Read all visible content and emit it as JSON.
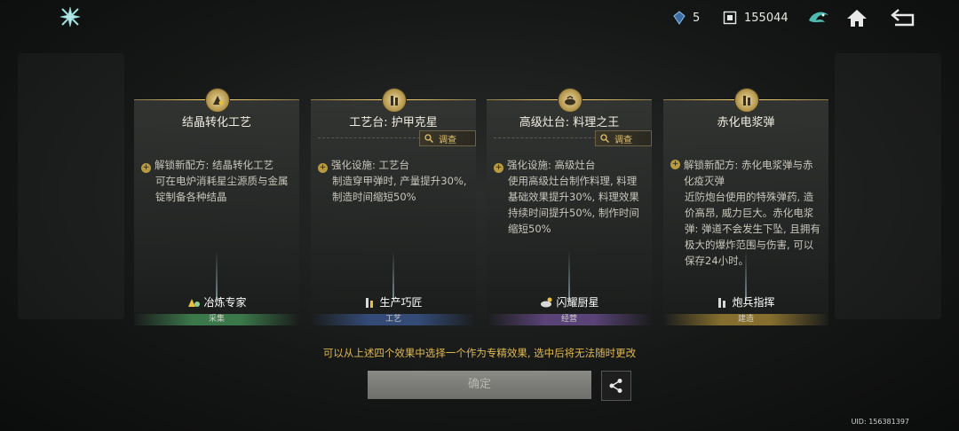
{
  "topbar": {
    "logo_icon": "shuriken-logo-icon",
    "resource1": {
      "icon": "crystal-icon",
      "value": "5"
    },
    "resource2": {
      "icon": "coin-icon",
      "value": "155044"
    },
    "buttons": [
      "dragon-emblem-icon",
      "home-icon",
      "back-icon"
    ]
  },
  "cards": [
    {
      "title": "结晶转化工艺",
      "badge_icon": "crystal-craft-icon",
      "lead": "解锁新配方: 结晶转化工艺",
      "body": "可在电炉消耗星尘源质与金属锭制备各种结晶",
      "skill": "冶炼专家",
      "category": "采集",
      "category_color": "#46965a"
    },
    {
      "title": "工艺台: 护甲克星",
      "badge_icon": "tower-icon",
      "inspect": "调查",
      "lead": "强化设施: 工艺台",
      "body": "制造穿甲弹时, 产量提升30%, 制造时间缩短50%",
      "skill": "生产巧匠",
      "category": "工艺",
      "category_color": "#3c5a96"
    },
    {
      "title": "高级灶台: 料理之王",
      "badge_icon": "cooking-pot-icon",
      "inspect": "调查",
      "lead": "强化设施: 高级灶台",
      "body": "使用高级灶台制作料理, 料理基础效果提升30%, 料理效果持续时间提升50%, 制作时间缩短50%",
      "skill": "闪耀厨星",
      "category": "经营",
      "category_color": "#6e5096"
    },
    {
      "title": "赤化电浆弹",
      "badge_icon": "tower-icon",
      "lead": "解锁新配方: 赤化电浆弹与赤化疫灭弹",
      "body": "近防炮台使用的特殊弹药, 造价高昂, 威力巨大。赤化电浆弹: 弹道不会发生下坠, 且拥有极大的爆炸范围与伤害, 可以保存24小时。",
      "skill": "炮兵指挥",
      "category": "建造",
      "category_color": "#a08232"
    }
  ],
  "hint": "可以从上述四个效果中选择一个作为专精效果, 选中后将无法随时更改",
  "confirm_label": "确定",
  "share_icon": "share-icon",
  "uid": "UID: 156381397"
}
